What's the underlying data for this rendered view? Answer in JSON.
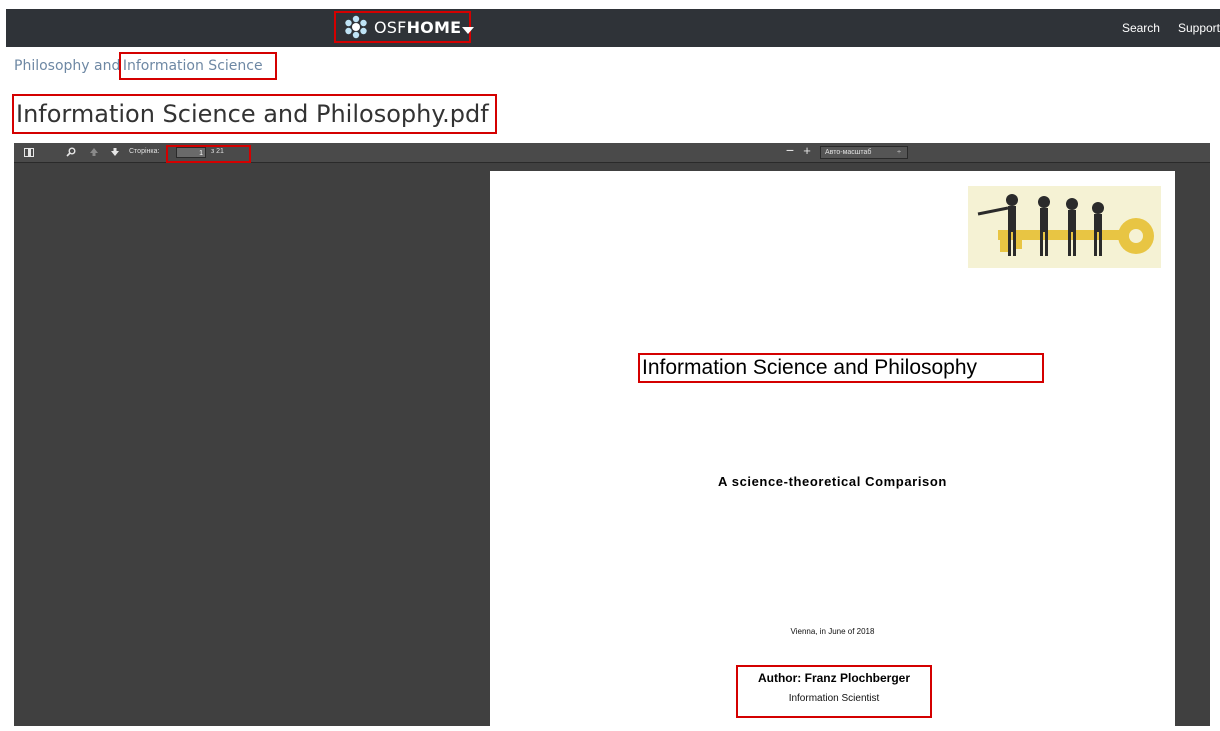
{
  "nav": {
    "brand_prefix": "OSF",
    "brand_name": "HOME",
    "links": [
      "Search",
      "Support"
    ]
  },
  "breadcrumb": {
    "parent": "Philosophy and",
    "current": "Information Science"
  },
  "file": {
    "title": "Information Science and Philosophy.pdf"
  },
  "viewer": {
    "page_label": "Сторінка:",
    "page_current": "1",
    "page_total": "з 21",
    "zoom_value": "Авто-масштаб",
    "zoom_arrow": "÷"
  },
  "document": {
    "title": "Information Science and Philosophy",
    "subtitle": "A science-theoretical Comparison",
    "date": "Vienna, in June of 2018",
    "author": "Author: Franz Plochberger",
    "author_role": "Information Scientist"
  },
  "colors": {
    "topbar": "#2f3338",
    "highlight": "#d40000",
    "viewer_bg": "#404040",
    "breadcrumb": "#6e88a4"
  }
}
